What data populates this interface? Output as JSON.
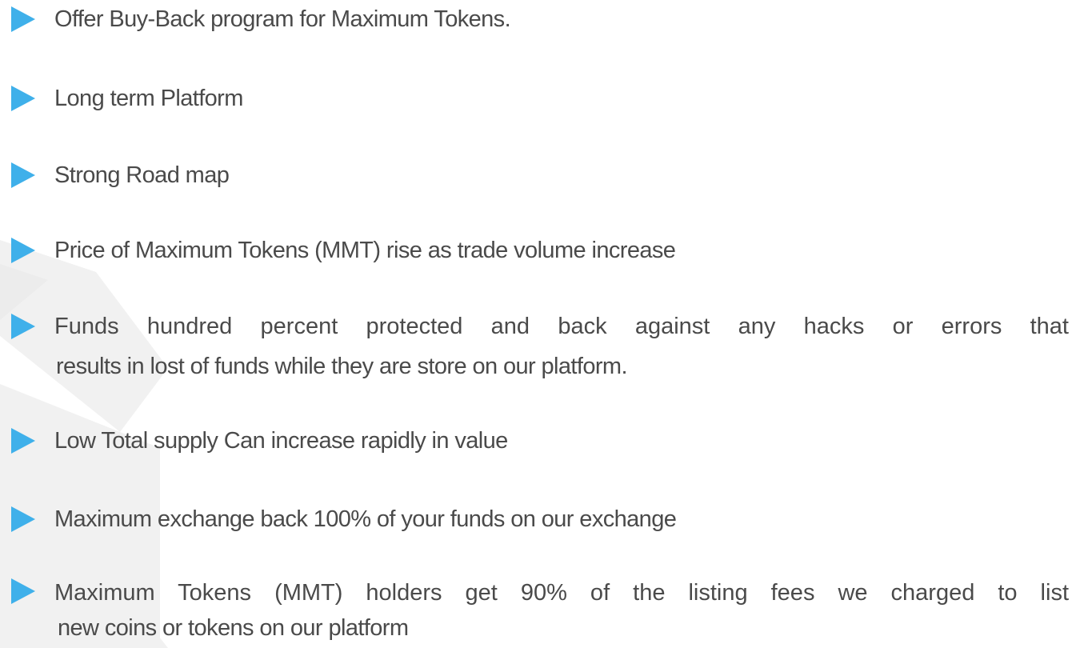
{
  "bullets": [
    {
      "line1": "Offer Buy-Back program for Maximum Tokens."
    },
    {
      "line1": "Long term Platform"
    },
    {
      "line1": "Strong Road map"
    },
    {
      "line1": "Price of Maximum Tokens (MMT) rise as trade volume increase"
    },
    {
      "line1": "Funds hundred percent protected and back against any hacks or errors that",
      "line2": "results in lost of funds while they are store on our platform."
    },
    {
      "line1": "Low Total supply Can increase rapidly in value"
    },
    {
      "line1": "Maximum exchange back 100% of your funds on our exchange"
    },
    {
      "line1": "Maximum Tokens (MMT) holders get 90% of the listing fees we charged to list",
      "line2": "new coins or tokens on our platform"
    }
  ],
  "colors": {
    "bullet_arrow": "#3fb0ea",
    "text": "#4a4a4a",
    "watermark": "#f0f0f0"
  },
  "icons": {
    "bullet": "triangle-right-icon",
    "background": "watermark-logo"
  }
}
